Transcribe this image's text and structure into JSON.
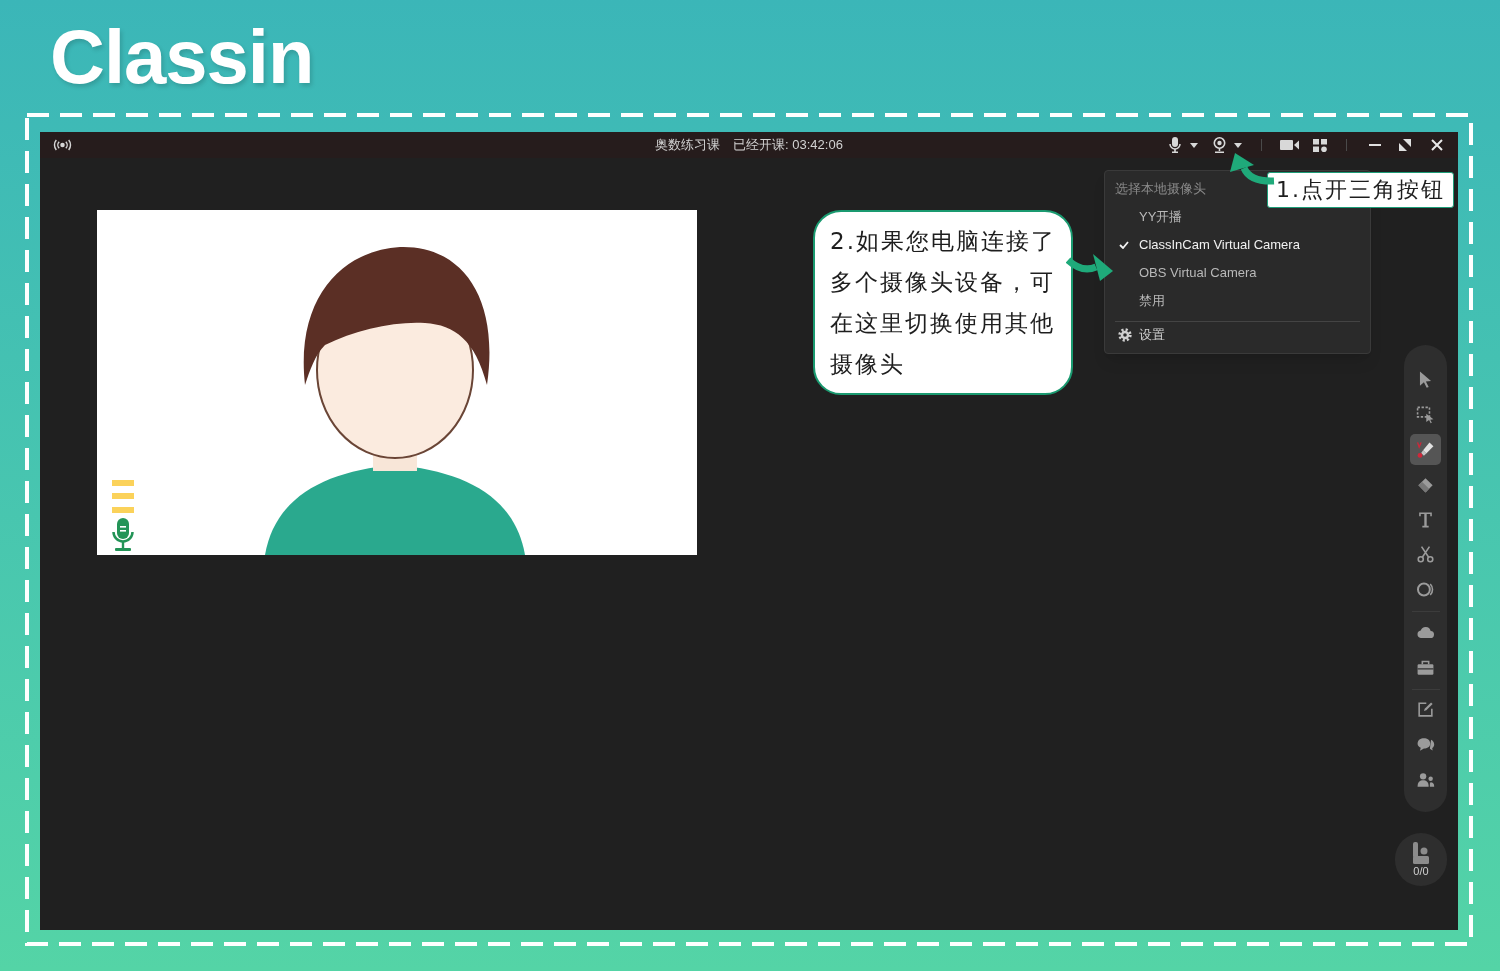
{
  "logo": {
    "text": "Classin"
  },
  "title_bar": {
    "course_name": "奥数练习课",
    "elapsed": "已经开课: 03:42:06"
  },
  "camera_menu": {
    "header": "选择本地摄像头",
    "items": [
      {
        "label": "YY开播",
        "selected": false
      },
      {
        "label": "ClassInCam Virtual Camera",
        "selected": true
      },
      {
        "label": "OBS Virtual Camera",
        "selected": false
      },
      {
        "label": "禁用",
        "selected": false
      }
    ],
    "settings_label": "设置"
  },
  "toolbar": {
    "groups": [
      {
        "tools": [
          {
            "kind": "pointer",
            "selected": false
          },
          {
            "kind": "select_area",
            "selected": false
          },
          {
            "kind": "pen",
            "selected": true
          },
          {
            "kind": "eraser",
            "selected": false
          },
          {
            "kind": "text",
            "selected": false
          },
          {
            "kind": "scissors",
            "selected": false
          },
          {
            "kind": "shape",
            "selected": false
          }
        ]
      },
      {
        "tools": [
          {
            "kind": "cloud",
            "selected": false
          },
          {
            "kind": "toolbox",
            "selected": false
          }
        ]
      },
      {
        "tools": [
          {
            "kind": "edit",
            "selected": false
          },
          {
            "kind": "chat",
            "selected": false
          },
          {
            "kind": "users",
            "selected": false
          }
        ]
      }
    ]
  },
  "seat_counter": {
    "text": "0/0"
  },
  "annotations": [
    {
      "kind": "box",
      "text": "1.点开三角按钮"
    },
    {
      "kind": "bubble",
      "text": "2.如果您电脑连接了多个摄像头设备，可在这里切换使用其他摄像头"
    }
  ]
}
